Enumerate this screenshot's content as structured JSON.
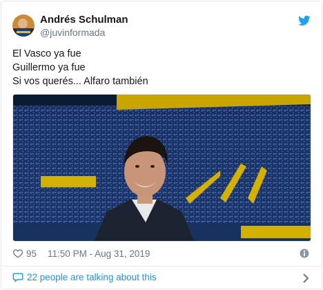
{
  "tweet": {
    "author_name": "Andrés Schulman",
    "author_handle": "@juvinformada",
    "lines": [
      "El Vasco ya fue",
      "Guillermo ya fue",
      "Si vos querés... Alfaro también"
    ],
    "likes": "95",
    "timestamp": "11:50 PM - Aug 31, 2019"
  },
  "footer": {
    "talking_label": "22 people are talking about this"
  },
  "icons": {
    "brand": "twitter-bird-icon",
    "like": "heart-icon",
    "info": "info-icon",
    "reply": "speech-bubble-icon",
    "more": "chevron-right-icon"
  },
  "colors": {
    "accent": "#1da1f2",
    "link": "#1b95e0",
    "muted": "#657786",
    "text": "#14171a"
  }
}
